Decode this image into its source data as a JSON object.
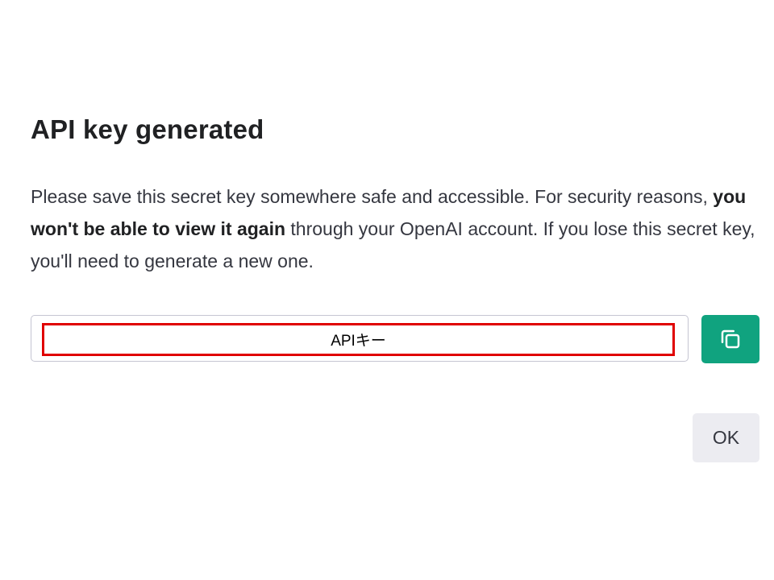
{
  "dialog": {
    "title": "API key generated",
    "description": {
      "part1": "Please save this secret key somewhere safe and accessible. For security reasons, ",
      "bold": "you won't be able to view it again",
      "part2": " through your OpenAI account. If you lose this secret key, you'll need to generate a new one."
    },
    "key_field": {
      "value": "APIキー"
    },
    "copy_button": {
      "icon": "copy-icon",
      "color": "#10a37f"
    },
    "ok_button": {
      "label": "OK"
    }
  },
  "colors": {
    "accent": "#10a37f",
    "highlight_border": "#e00000",
    "secondary_button": "#ececf1"
  }
}
